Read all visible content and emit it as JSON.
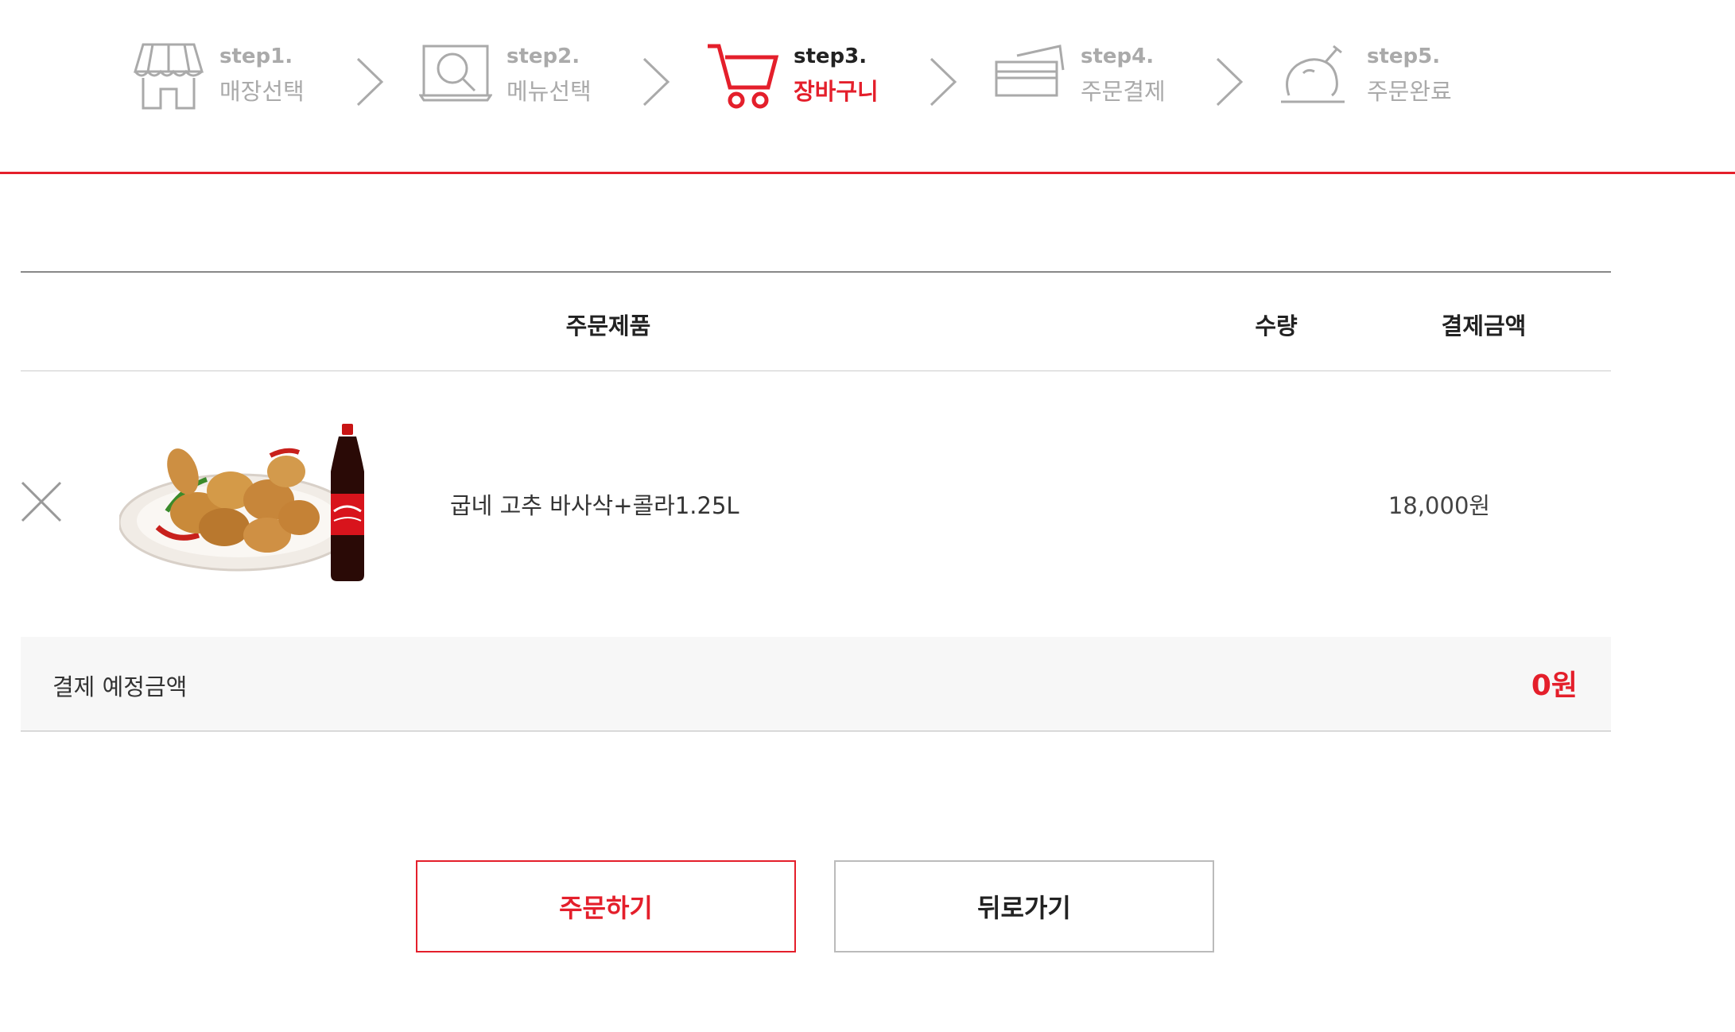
{
  "steps": [
    {
      "num": "step1.",
      "name": "매장선택",
      "icon": "store-icon"
    },
    {
      "num": "step2.",
      "name": "메뉴선택",
      "icon": "menu-search-icon"
    },
    {
      "num": "step3.",
      "name": "장바구니",
      "icon": "cart-icon"
    },
    {
      "num": "step4.",
      "name": "주문결제",
      "icon": "card-payment-icon"
    },
    {
      "num": "step5.",
      "name": "주문완료",
      "icon": "chicken-done-icon"
    }
  ],
  "active_step": 3,
  "table": {
    "headers": {
      "product": "주문제품",
      "qty": "수량",
      "amount": "결제금액"
    },
    "rows": [
      {
        "name": "굽네 고추 바사삭+콜라1.25L",
        "qty": "",
        "price": "18,000원"
      }
    ]
  },
  "total": {
    "label": "결제 예정금액",
    "amount": "0원"
  },
  "buttons": {
    "order": "주문하기",
    "back": "뒤로가기"
  },
  "colors": {
    "accent": "#e41f2b",
    "inactive": "#aaaaaa"
  }
}
